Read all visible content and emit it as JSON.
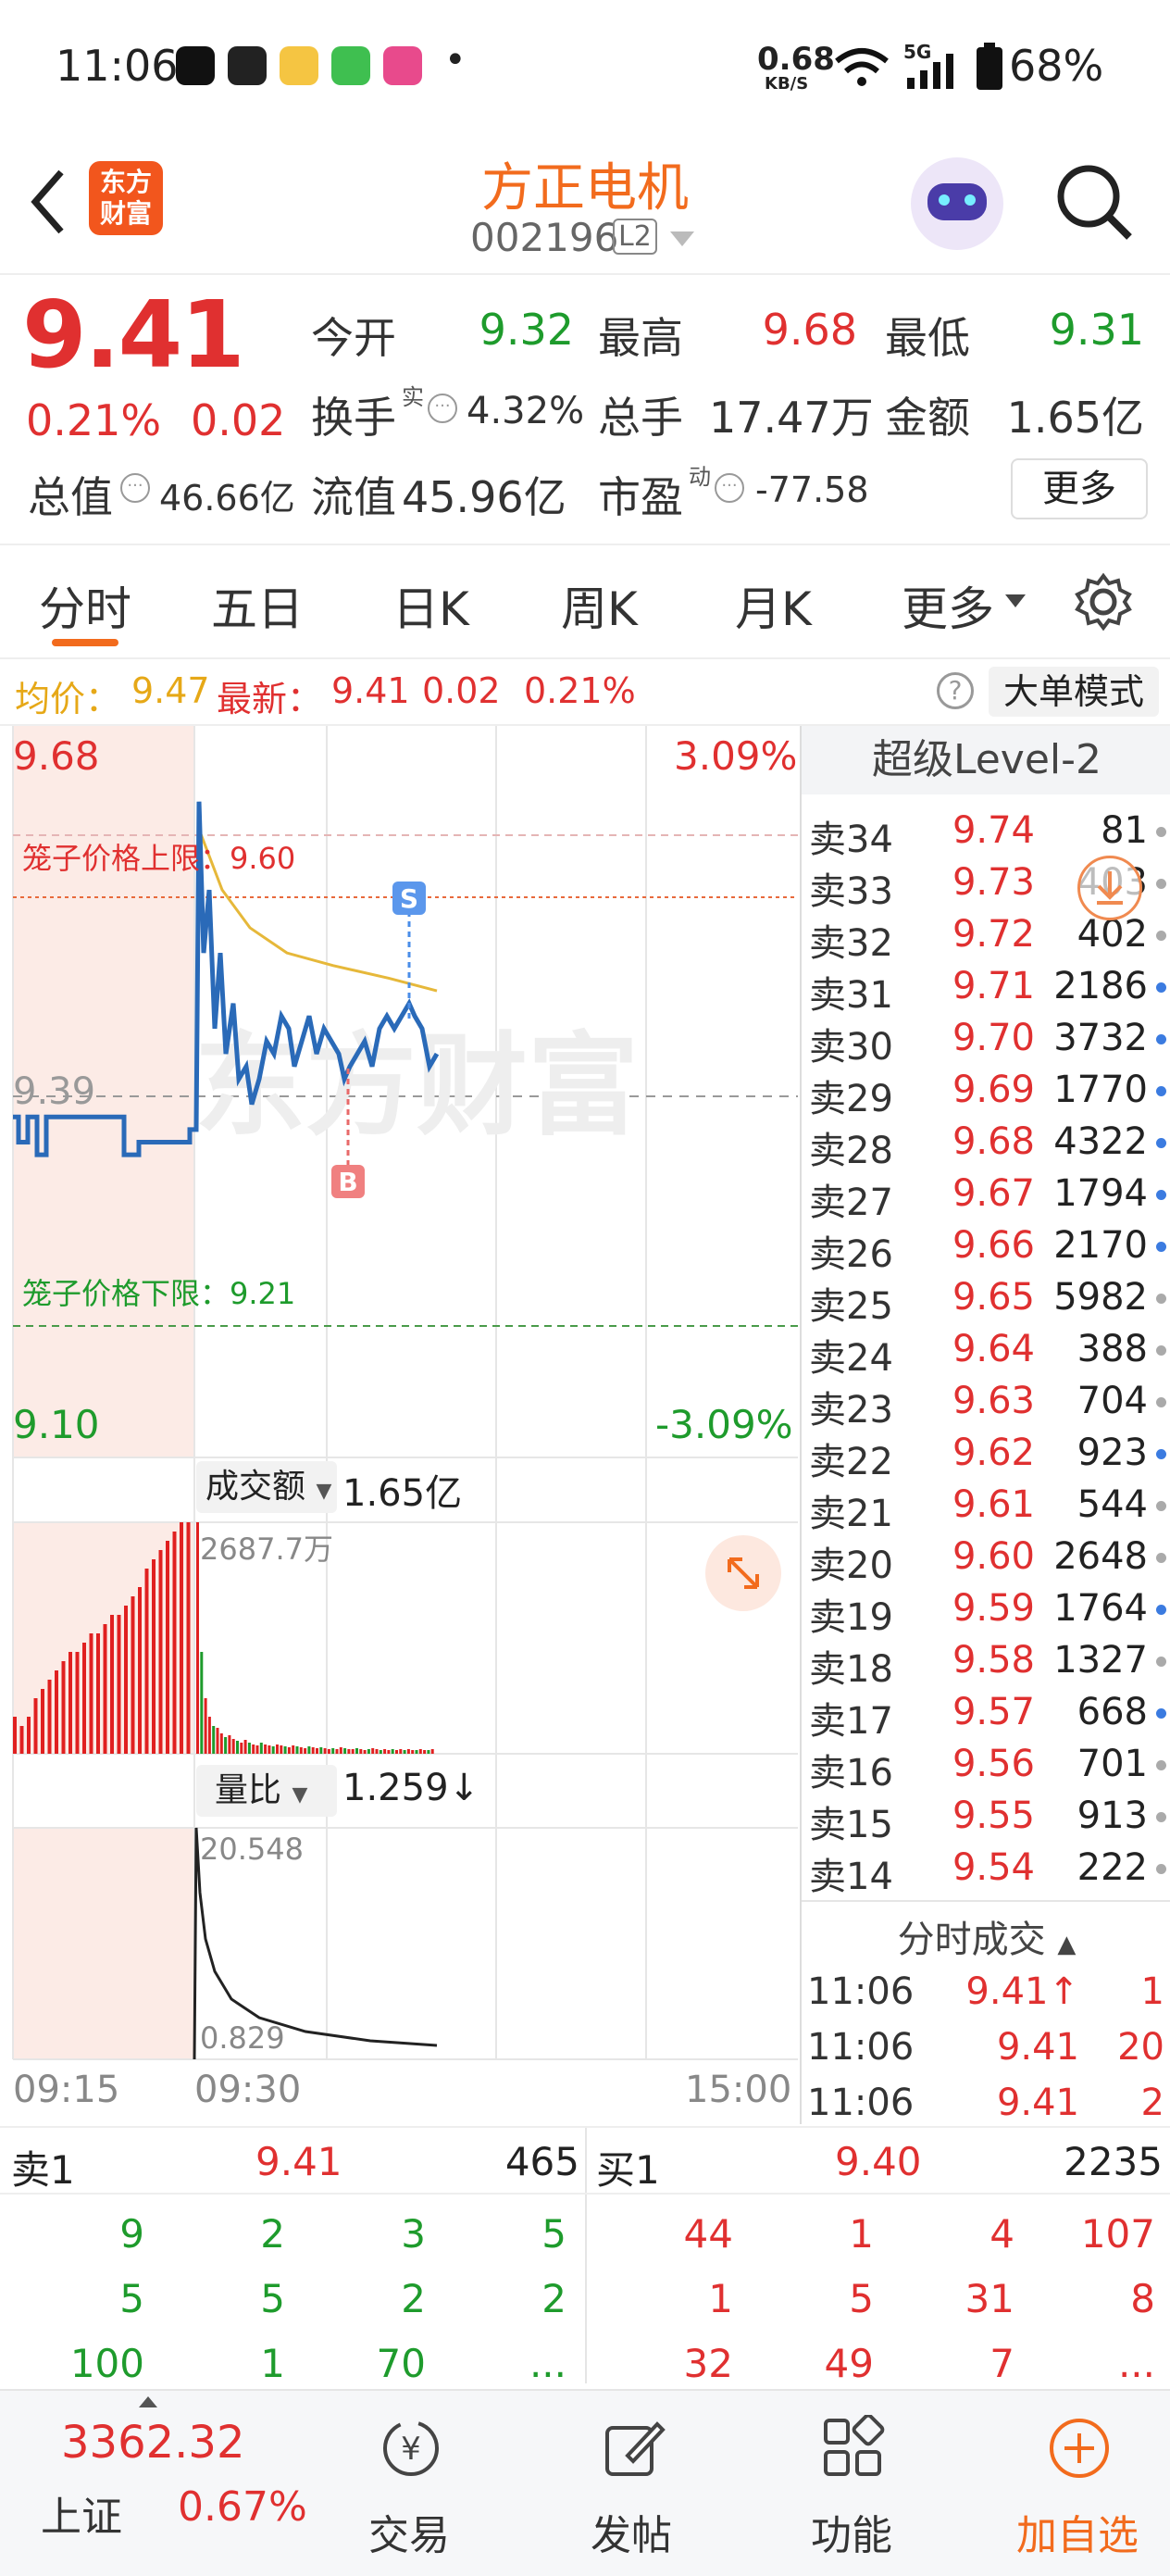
{
  "status_bar": {
    "time": "11:06",
    "net_speed": "0.68",
    "net_unit": "KB/S",
    "signal": "5G",
    "battery": "68%",
    "dot": "•"
  },
  "header": {
    "app_logo_line1": "东方",
    "app_logo_line2": "财富",
    "stock_name": "方正电机",
    "stock_code": "002196",
    "level_badge": "L2"
  },
  "quote": {
    "price": "9.41",
    "change_pct": "0.21%",
    "change_amt": "0.02",
    "open_label": "今开",
    "open": "9.32",
    "high_label": "最高",
    "high": "9.68",
    "low_label": "最低",
    "low": "9.31",
    "turnover_label": "换手",
    "turnover_sup": "实",
    "turnover": "4.32%",
    "volume_label": "总手",
    "volume": "17.47万",
    "amount_label": "金额",
    "amount": "1.65亿",
    "mktcap_label": "总值",
    "mktcap": "46.66亿",
    "float_label": "流值",
    "float": "45.96亿",
    "pe_label": "市盈",
    "pe_sup": "动",
    "pe": "-77.58",
    "more_button": "更多"
  },
  "tabs": [
    "分时",
    "五日",
    "日K",
    "周K",
    "月K",
    "更多"
  ],
  "info_row": {
    "avg_label": "均价：",
    "avg": "9.47",
    "latest_label": "最新：",
    "latest": "9.41",
    "latest_chg": "0.02",
    "latest_pct": "0.21%",
    "big_order_button": "大单模式"
  },
  "chart": {
    "y_top": "9.68",
    "y_top_pct": "3.09%",
    "y_bottom": "9.10",
    "y_bottom_pct": "-3.09%",
    "y_mid": "9.39",
    "upper_limit_label": "笼子价格上限：9.60",
    "lower_limit_label": "笼子价格下限：9.21",
    "sell_marker": "S",
    "buy_marker": "B",
    "watermark": "东方财富",
    "vol_selector": "成交额",
    "vol_total": "1.65亿",
    "vol_max": "2687.7万",
    "ratio_selector": "量比",
    "ratio_value": "1.259↓",
    "ratio_max": "20.548",
    "ratio_min": "0.829",
    "time_start": "09:15",
    "time_open": "09:30",
    "time_end": "15:00"
  },
  "level2": {
    "title": "超级Level-2",
    "asks": [
      {
        "label": "卖34",
        "price": "9.74",
        "qty": "81",
        "dot": "gray"
      },
      {
        "label": "卖33",
        "price": "9.73",
        "qty": "403",
        "dot": "gray"
      },
      {
        "label": "卖32",
        "price": "9.72",
        "qty": "402",
        "dot": "gray"
      },
      {
        "label": "卖31",
        "price": "9.71",
        "qty": "2186",
        "dot": "blue"
      },
      {
        "label": "卖30",
        "price": "9.70",
        "qty": "3732",
        "dot": "blue"
      },
      {
        "label": "卖29",
        "price": "9.69",
        "qty": "1770",
        "dot": "blue"
      },
      {
        "label": "卖28",
        "price": "9.68",
        "qty": "4322",
        "dot": "blue"
      },
      {
        "label": "卖27",
        "price": "9.67",
        "qty": "1794",
        "dot": "blue"
      },
      {
        "label": "卖26",
        "price": "9.66",
        "qty": "2170",
        "dot": "blue"
      },
      {
        "label": "卖25",
        "price": "9.65",
        "qty": "5982",
        "dot": "gray"
      },
      {
        "label": "卖24",
        "price": "9.64",
        "qty": "388",
        "dot": "gray"
      },
      {
        "label": "卖23",
        "price": "9.63",
        "qty": "704",
        "dot": "gray"
      },
      {
        "label": "卖22",
        "price": "9.62",
        "qty": "923",
        "dot": "blue"
      },
      {
        "label": "卖21",
        "price": "9.61",
        "qty": "544",
        "dot": "gray"
      },
      {
        "label": "卖20",
        "price": "9.60",
        "qty": "2648",
        "dot": "gray"
      },
      {
        "label": "卖19",
        "price": "9.59",
        "qty": "1764",
        "dot": "blue"
      },
      {
        "label": "卖18",
        "price": "9.58",
        "qty": "1327",
        "dot": "gray"
      },
      {
        "label": "卖17",
        "price": "9.57",
        "qty": "668",
        "dot": "blue"
      },
      {
        "label": "卖16",
        "price": "9.56",
        "qty": "701",
        "dot": "gray"
      },
      {
        "label": "卖15",
        "price": "9.55",
        "qty": "913",
        "dot": "gray"
      },
      {
        "label": "卖14",
        "price": "9.54",
        "qty": "222",
        "dot": "gray"
      }
    ],
    "ticks_title": "分时成交",
    "ticks": [
      {
        "time": "11:06",
        "price": "9.41↑",
        "qty": "1"
      },
      {
        "time": "11:06",
        "price": "9.41",
        "qty": "20"
      },
      {
        "time": "11:06",
        "price": "9.41",
        "qty": "2"
      }
    ]
  },
  "orderbook": {
    "sell1_label": "卖1",
    "sell1_price": "9.41",
    "sell1_qty": "465",
    "buy1_label": "买1",
    "buy1_price": "9.40",
    "buy1_qty": "2235",
    "sell_queue": [
      [
        "9",
        "2",
        "3",
        "5"
      ],
      [
        "5",
        "5",
        "2",
        "2"
      ],
      [
        "100",
        "1",
        "70",
        "..."
      ]
    ],
    "buy_queue": [
      [
        "44",
        "1",
        "4",
        "107"
      ],
      [
        "1",
        "5",
        "31",
        "8"
      ],
      [
        "32",
        "49",
        "7",
        "..."
      ]
    ]
  },
  "bottom_nav": {
    "index_value": "3362.32",
    "index_name": "上证",
    "index_pct": "0.67%",
    "trade": "交易",
    "post": "发帖",
    "function": "功能",
    "add_watch": "加自选"
  },
  "colors": {
    "up": "#e03030",
    "down": "#1e9b2c",
    "accent": "#f26b1d",
    "line": "#2a6ab8",
    "avg": "#e6a817"
  }
}
